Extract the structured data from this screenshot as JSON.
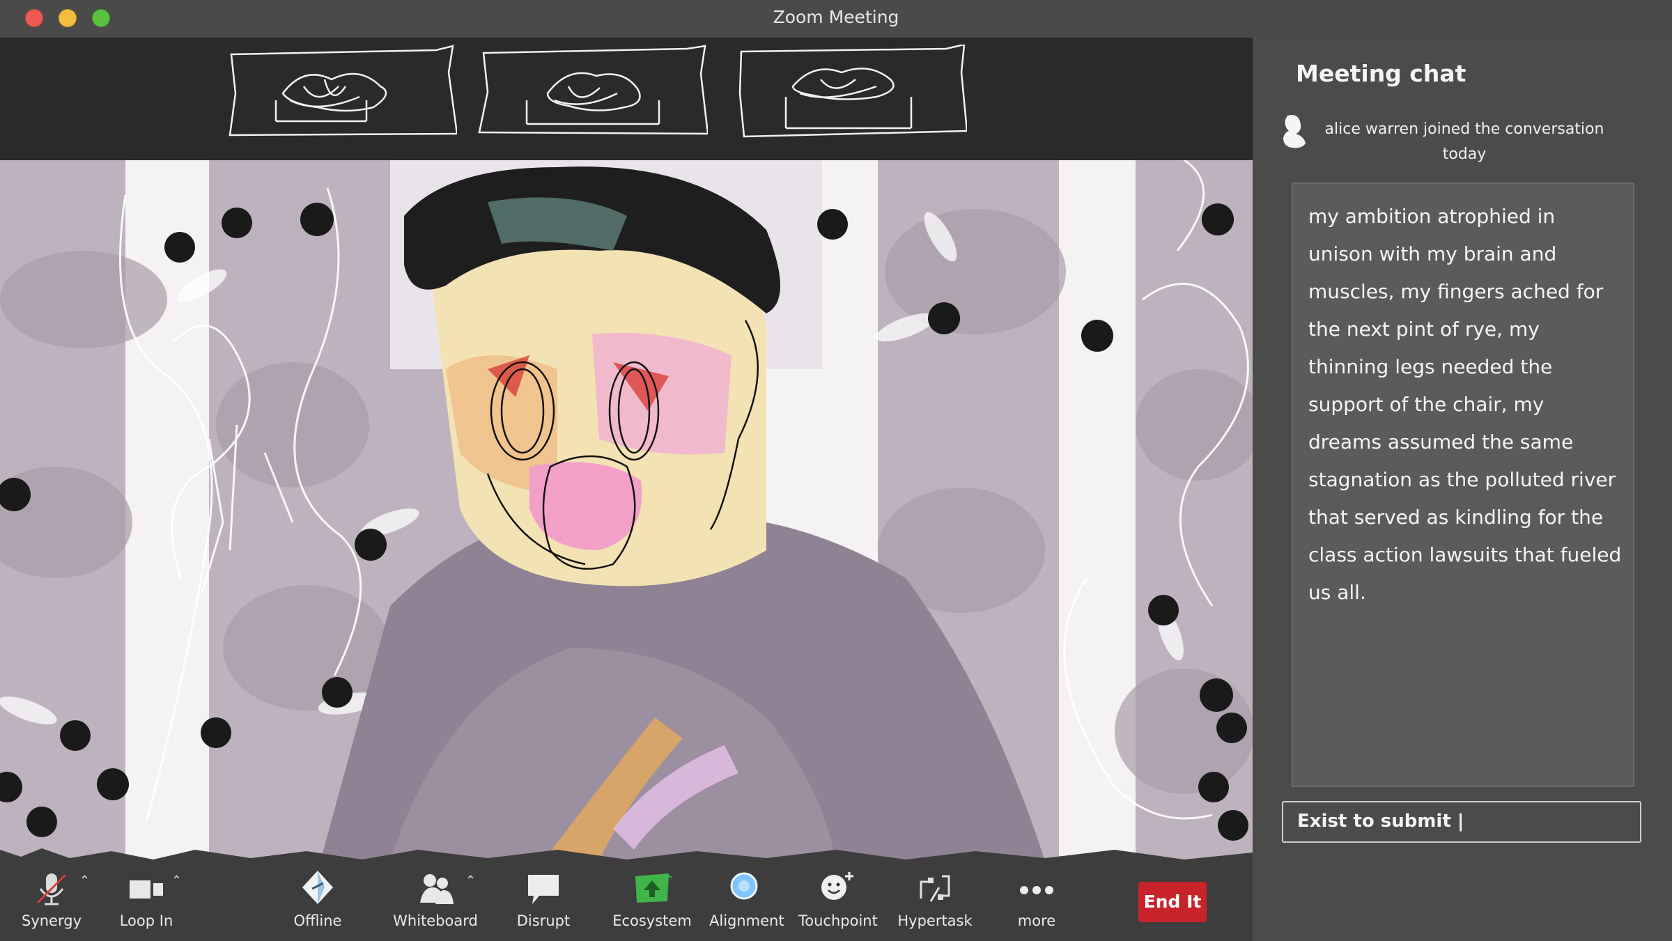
{
  "window": {
    "title": "Zoom Meeting"
  },
  "chat": {
    "title": "Meeting chat",
    "join_user": "alice warren",
    "join_text": "joined the conversation today",
    "message": "my ambition atrophied in unison with my brain and muscles, my fingers ached for the next pint of rye, my thinning legs needed the support of the chair, my dreams assumed the same stagnation as the polluted river that served as kindling for the class action lawsuits that fueled us all.",
    "input_label": "Exist to submit |"
  },
  "toolbar": {
    "synergy": "Synergy",
    "loop_in": "Loop In",
    "offline": "Offline",
    "whiteboard": "Whiteboard",
    "disrupt": "Disrupt",
    "ecosystem": "Ecosystem",
    "alignment": "Alignment",
    "touchpoint": "Touchpoint",
    "hypertask": "Hypertask",
    "more": "more",
    "end": "End It"
  },
  "colors": {
    "end_button": "#c8232b",
    "ecosystem_icon": "#3fb54a",
    "alignment_icon": "#7fc4ff",
    "background": "#3b3b3b"
  }
}
